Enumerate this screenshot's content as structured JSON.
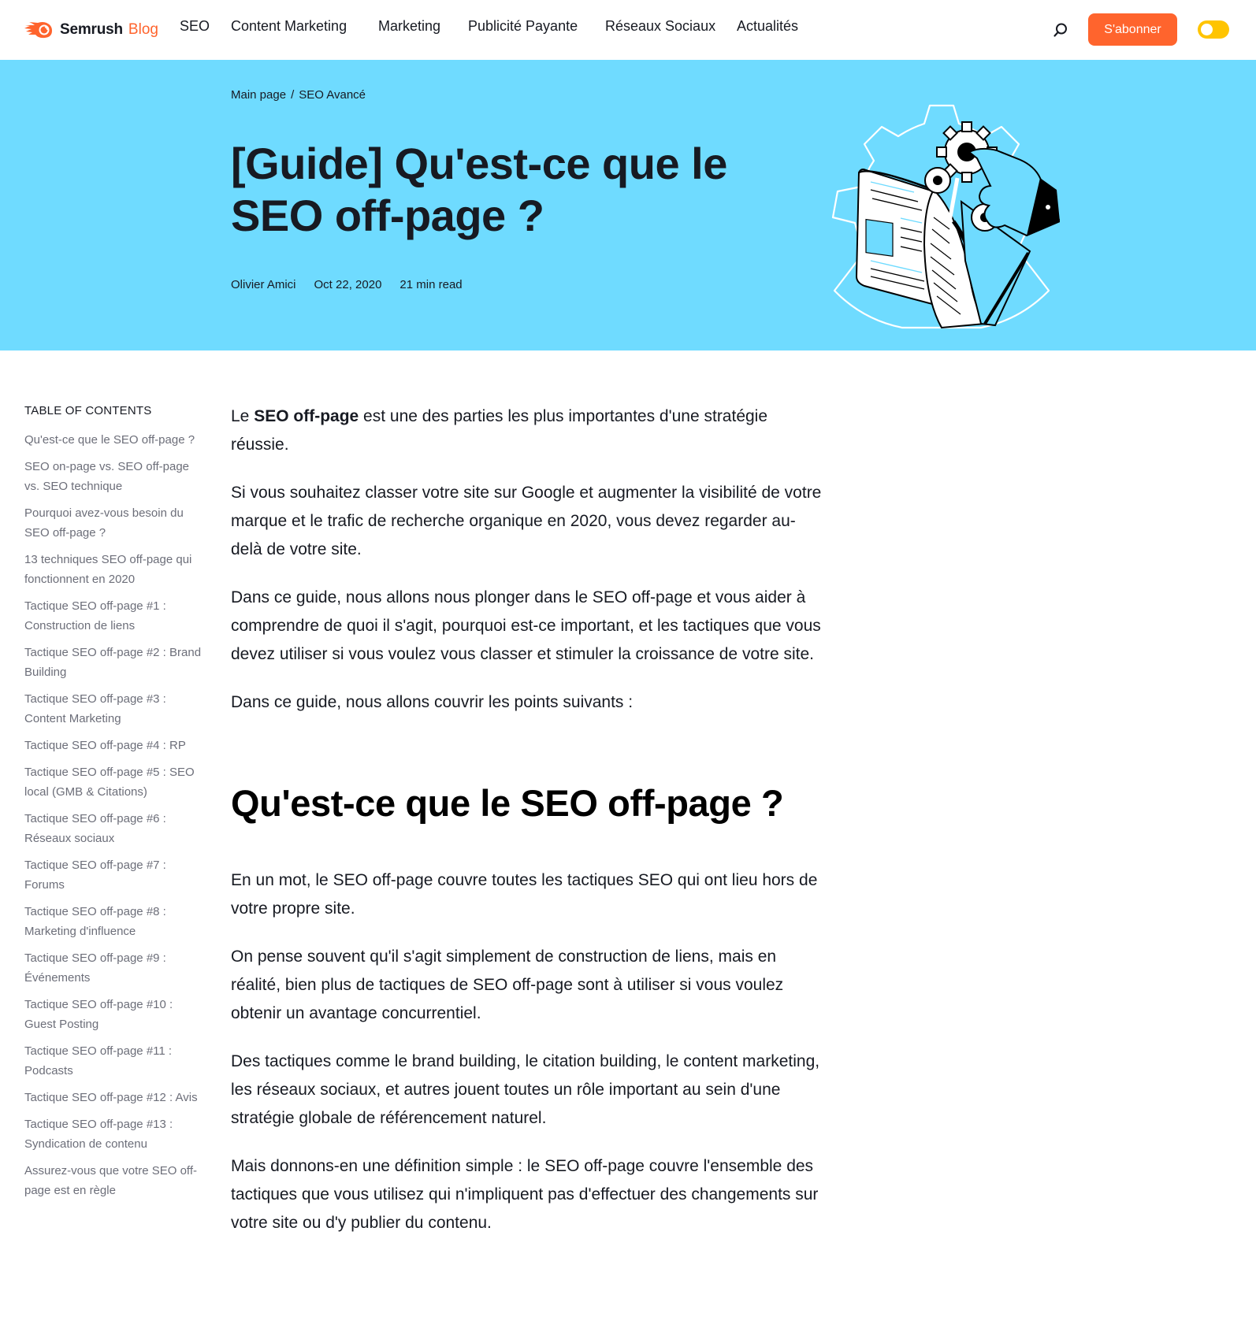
{
  "brand": {
    "name": "Semrush",
    "section": "Blog",
    "accent_color": "#ff642d",
    "hero_color": "#6fdbff",
    "toggle_color": "#ffc400"
  },
  "nav": {
    "items": [
      {
        "label": "SEO"
      },
      {
        "label": "Content Marketing"
      },
      {
        "label": "Marketing"
      },
      {
        "label": "Publicité Payante"
      },
      {
        "label": "Réseaux Sociaux"
      },
      {
        "label": "Actualités"
      }
    ],
    "search_icon": "search-icon",
    "subscribe_label": "S'abonner",
    "theme_toggle_icon": "theme-toggle"
  },
  "hero": {
    "breadcrumb": [
      {
        "label": "Main page"
      },
      {
        "label": "SEO Avancé"
      }
    ],
    "breadcrumb_separator": "/",
    "title": "[Guide] Qu'est-ce que le SEO off-page ?",
    "author": "Olivier Amici",
    "date": "Oct 22, 2020",
    "read_time": "21 min read"
  },
  "toc": {
    "title": "TABLE OF CONTENTS",
    "items": [
      {
        "label": "Qu'est-ce que le SEO off-page ?"
      },
      {
        "label": "SEO on-page vs. SEO off-page vs. SEO technique"
      },
      {
        "label": "Pourquoi avez-vous besoin du SEO off-page ?"
      },
      {
        "label": "13 techniques SEO off-page qui fonctionnent en 2020"
      },
      {
        "label": "Tactique SEO off-page #1 : Construction de liens"
      },
      {
        "label": "Tactique SEO off-page #2 : Brand Building"
      },
      {
        "label": "Tactique SEO off-page #3 : Content Marketing"
      },
      {
        "label": "Tactique SEO off-page #4 : RP"
      },
      {
        "label": "Tactique SEO off-page #5 : SEO local (GMB & Citations)"
      },
      {
        "label": "Tactique SEO off-page #6 : Réseaux sociaux"
      },
      {
        "label": "Tactique SEO off-page #7 : Forums"
      },
      {
        "label": "Tactique SEO off-page #8 : Marketing d'influence"
      },
      {
        "label": "Tactique SEO off-page #9 : Événements"
      },
      {
        "label": "Tactique SEO off-page #10 : Guest Posting"
      },
      {
        "label": "Tactique SEO off-page #11 : Podcasts"
      },
      {
        "label": "Tactique SEO off-page #12 : Avis"
      },
      {
        "label": "Tactique SEO off-page #13 : Syndication de contenu"
      },
      {
        "label": "Assurez-vous que votre SEO off-page est en règle"
      }
    ]
  },
  "article": {
    "intro": {
      "prefix": "Le ",
      "bold": "SEO off-page",
      "suffix": " est une des parties les plus importantes d'une stratégie réussie."
    },
    "paragraphs_before_heading": [
      "Si vous souhaitez classer votre site sur Google et augmenter la visibilité de votre marque et le trafic de recherche organique en 2020, vous devez regarder au-delà de votre site.",
      "Dans ce guide, nous allons nous plonger dans le SEO off-page et vous aider à comprendre de quoi il s'agit, pourquoi est-ce important, et les tactiques que vous devez utiliser si vous voulez vous classer et stimuler la croissance de votre site."
    ],
    "lead_in": "Dans ce guide, nous allons couvrir les points suivants :",
    "heading": "Qu'est-ce que le SEO off-page ?",
    "paragraphs_after_heading": [
      "En un mot, le SEO off-page couvre toutes les tactiques SEO qui ont lieu hors de votre propre site.",
      "On pense souvent qu'il s'agit simplement de construction de liens, mais en réalité, bien plus de tactiques de SEO off-page sont à utiliser si vous voulez obtenir un avantage concurrentiel.",
      "Des tactiques comme le brand building, le citation building, le content marketing, les réseaux sociaux, et autres jouent toutes un rôle important au sein d'une stratégie globale de référencement naturel.",
      "Mais donnons-en une définition simple : le SEO off-page couvre l'ensemble des tactiques que vous utilisez qui n'impliquent pas d'effectuer des changements sur votre site ou d'y publier du contenu."
    ]
  }
}
